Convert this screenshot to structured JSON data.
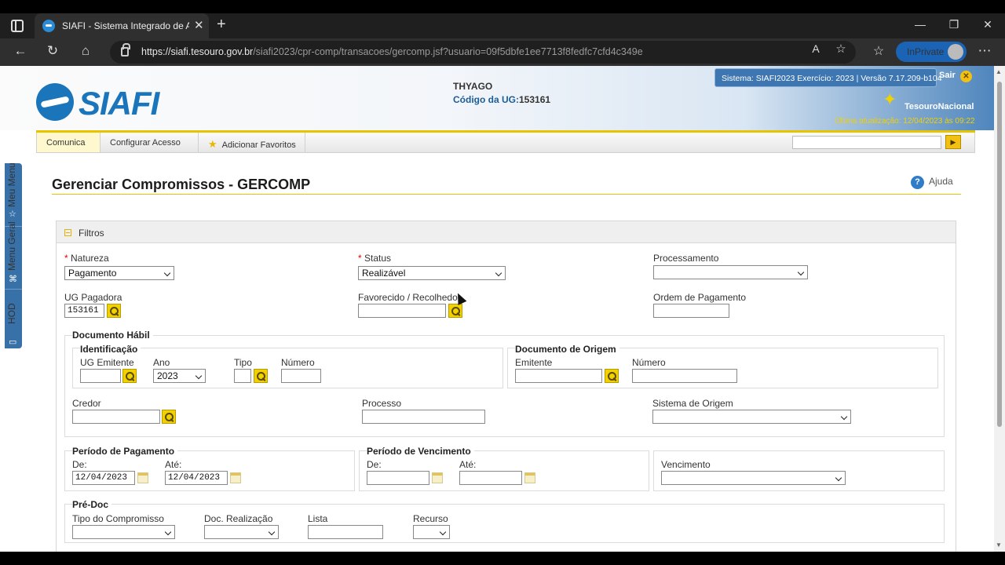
{
  "browser": {
    "tab_title": "SIAFI - Sistema Integrado de Adm",
    "url_host": "https://siafi.tesouro.gov.br",
    "url_path": "/siafi2023/cpr-comp/transacoes/gercomp.jsf?usuario=09f5dbfe1ee7713f8fedfc7cfd4c349e",
    "inprivate_label": "InPrivate",
    "icons": [
      "tab-actions-icon",
      "close-icon",
      "plus-icon",
      "minimize-icon",
      "restore-icon",
      "back-icon",
      "refresh-icon",
      "home-icon",
      "lock-icon",
      "read-aloud-icon",
      "favorite-add-icon",
      "favorites-icon",
      "more-icon"
    ]
  },
  "header": {
    "logo_text": "SIAFI",
    "user_name": "THYAGO",
    "ug_label": "Código da UG:",
    "ug_value": "153161",
    "system_info": "Sistema: SIAFI2023 Exercício: 2023 | Versão 7.17.209-b104",
    "sair": "Sair",
    "tesouro": "TesouroNacional",
    "last_update": "Última atualização: 12/04/2023 às 09:22"
  },
  "menu": {
    "items": [
      "Comunica",
      "Configurar Acesso",
      "Adicionar Favoritos"
    ]
  },
  "sidebar": {
    "tabs": [
      "Meu Menu",
      "Menu Geral",
      "HOD"
    ]
  },
  "page": {
    "title": "Gerenciar Compromissos - GERCOMP",
    "help": "Ajuda"
  },
  "filters": {
    "section_title": "Filtros",
    "natureza_label": "Natureza",
    "natureza_value": "Pagamento",
    "status_label": "Status",
    "status_value": "Realizável",
    "processamento_label": "Processamento",
    "processamento_value": "",
    "ug_pagadora_label": "UG Pagadora",
    "ug_pagadora_value": "153161",
    "favorecido_label": "Favorecido / Recolhedor",
    "ordem_label": "Ordem de Pagamento",
    "documento_habil": {
      "title": "Documento Hábil",
      "identificacao_title": "Identificação",
      "ug_emitente_label": "UG Emitente",
      "ano_label": "Ano",
      "ano_value": "2023",
      "tipo_label": "Tipo",
      "numero_label": "Número",
      "origem_title": "Documento de Origem",
      "emitente_label": "Emitente",
      "origem_numero_label": "Número",
      "credor_label": "Credor",
      "processo_label": "Processo",
      "sistema_origem_label": "Sistema de Origem"
    },
    "periodo_pagamento": {
      "title": "Período de Pagamento",
      "de_label": "De:",
      "de_value": "12/04/2023",
      "ate_label": "Até:",
      "ate_value": "12/04/2023"
    },
    "periodo_vencimento": {
      "title": "Período de Vencimento",
      "de_label": "De:",
      "ate_label": "Até:"
    },
    "vencimento_label": "Vencimento",
    "pre_doc": {
      "title": "Pré-Doc",
      "tipo_compromisso_label": "Tipo do Compromisso",
      "doc_realizacao_label": "Doc. Realização",
      "lista_label": "Lista",
      "recurso_label": "Recurso"
    }
  },
  "colors": {
    "brand_blue": "#1b75bb",
    "accent_yellow": "#e8c400",
    "required_red": "#ee0000"
  }
}
